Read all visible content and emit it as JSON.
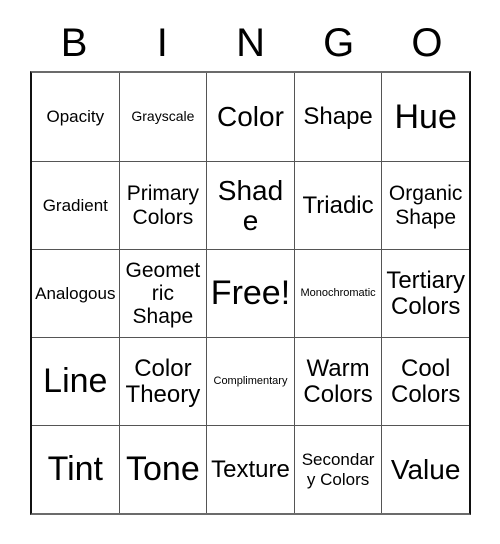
{
  "card": {
    "title": "BINGO",
    "header_letters": [
      "B",
      "I",
      "N",
      "G",
      "O"
    ],
    "free_space": "Free!",
    "grid": [
      [
        {
          "label": "Opacity",
          "size": "md"
        },
        {
          "label": "Grayscale",
          "size": "sm"
        },
        {
          "label": "Color",
          "size": "2xl"
        },
        {
          "label": "Shape",
          "size": "xl"
        },
        {
          "label": "Hue",
          "size": "3xl"
        }
      ],
      [
        {
          "label": "Gradient",
          "size": "md"
        },
        {
          "label": "Primary Colors",
          "size": "lg"
        },
        {
          "label": "Shade",
          "size": "2xl"
        },
        {
          "label": "Triadic",
          "size": "xl"
        },
        {
          "label": "Organic Shape",
          "size": "lg"
        }
      ],
      [
        {
          "label": "Analogous",
          "size": "md"
        },
        {
          "label": "Geometric Shape",
          "size": "lg"
        },
        {
          "label": "Free!",
          "size": "3xl"
        },
        {
          "label": "Monochromatic",
          "size": "xs"
        },
        {
          "label": "Tertiary Colors",
          "size": "xl"
        }
      ],
      [
        {
          "label": "Line",
          "size": "3xl"
        },
        {
          "label": "Color Theory",
          "size": "xl"
        },
        {
          "label": "Complimentary",
          "size": "xs"
        },
        {
          "label": "Warm Colors",
          "size": "xl"
        },
        {
          "label": "Cool Colors",
          "size": "xl"
        }
      ],
      [
        {
          "label": "Tint",
          "size": "3xl"
        },
        {
          "label": "Tone",
          "size": "3xl"
        },
        {
          "label": "Texture",
          "size": "xl"
        },
        {
          "label": "Secondary Colors",
          "size": "md"
        },
        {
          "label": "Value",
          "size": "2xl"
        }
      ]
    ]
  },
  "colors": {
    "background": "#ffffff",
    "text": "#000000",
    "grid_border": "#111111",
    "cell_divider": "#555555"
  }
}
